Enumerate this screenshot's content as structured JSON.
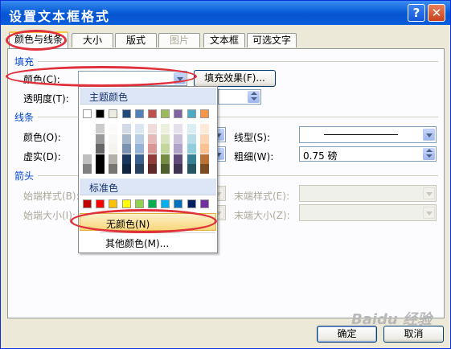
{
  "window": {
    "title": "设置文本框格式",
    "help_label": "?",
    "close_label": "✕"
  },
  "tabs": [
    {
      "label": "颜色与线条",
      "state": "active"
    },
    {
      "label": "大小",
      "state": "normal"
    },
    {
      "label": "版式",
      "state": "normal"
    },
    {
      "label": "图片",
      "state": "disabled"
    },
    {
      "label": "文本框",
      "state": "normal"
    },
    {
      "label": "可选文字",
      "state": "normal"
    }
  ],
  "fill": {
    "section": "填充",
    "color_label": "颜色(C):",
    "effects_button": "填充效果(F)...",
    "transparency_label": "透明度(T):"
  },
  "line": {
    "section": "线条",
    "color_label": "颜色(O):",
    "dash_label": "虚实(D):",
    "style_label": "线型(S):",
    "weight_label": "粗细(W):",
    "weight_value": "0.75 磅"
  },
  "arrows": {
    "section": "箭头",
    "begin_style_label": "始端样式(B):",
    "begin_size_label": "始端大小(I):",
    "end_style_label": "末端样式(E):",
    "end_size_label": "末端大小(Z):"
  },
  "color_popup": {
    "theme_header": "主题颜色",
    "standard_header": "标准色",
    "no_color": "无颜色(N)",
    "more_colors": "其他颜色(M)...",
    "theme_colors": [
      "#ffffff",
      "#000000",
      "#eeece1",
      "#1f497d",
      "#4f81bd",
      "#c0504d",
      "#9bbb59",
      "#8064a2",
      "#4bacc6",
      "#f79646"
    ],
    "standard_colors": [
      "#c00000",
      "#ff0000",
      "#ffc000",
      "#ffff00",
      "#92d050",
      "#00b050",
      "#00b0f0",
      "#0070c0",
      "#002060",
      "#7030a0"
    ]
  },
  "buttons": {
    "ok": "确定",
    "cancel": "取消"
  },
  "watermark": "Baidu 经验",
  "accent_colors": {
    "highlight_oval": "#e0303a",
    "title_bar": "#0a5fd8",
    "section_text": "#0046d5"
  }
}
